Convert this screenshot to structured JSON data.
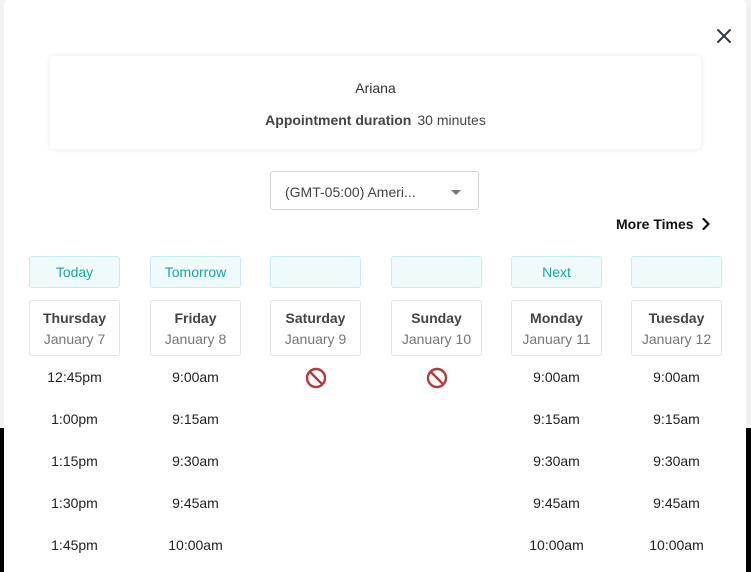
{
  "card": {
    "name": "Ariana",
    "duration_label": "Appointment duration",
    "duration_value": "30 minutes"
  },
  "timezone": {
    "value": "(GMT-05:00) Ameri..."
  },
  "more_times": {
    "label": "More Times"
  },
  "icons": {
    "close": "close-icon",
    "more": "chevron-right-icon",
    "unavailable": "no-entry-icon"
  },
  "colors": {
    "accent": "#1aa59b",
    "badge_bg": "#effbfa",
    "unavailable": "#b23b3b"
  },
  "days": [
    {
      "badge": "Today",
      "name": "Thursday",
      "date": "January 7",
      "available": true,
      "slots": [
        "12:45pm",
        "1:00pm",
        "1:15pm",
        "1:30pm",
        "1:45pm"
      ]
    },
    {
      "badge": "Tomorrow",
      "name": "Friday",
      "date": "January 8",
      "available": true,
      "slots": [
        "9:00am",
        "9:15am",
        "9:30am",
        "9:45am",
        "10:00am"
      ]
    },
    {
      "badge": "",
      "name": "Saturday",
      "date": "January 9",
      "available": false,
      "slots": []
    },
    {
      "badge": "",
      "name": "Sunday",
      "date": "January 10",
      "available": false,
      "slots": []
    },
    {
      "badge": "Next",
      "name": "Monday",
      "date": "January 11",
      "available": true,
      "slots": [
        "9:00am",
        "9:15am",
        "9:30am",
        "9:45am",
        "10:00am"
      ]
    },
    {
      "badge": "",
      "name": "Tuesday",
      "date": "January 12",
      "available": true,
      "slots": [
        "9:00am",
        "9:15am",
        "9:30am",
        "9:45am",
        "10:00am"
      ]
    }
  ]
}
